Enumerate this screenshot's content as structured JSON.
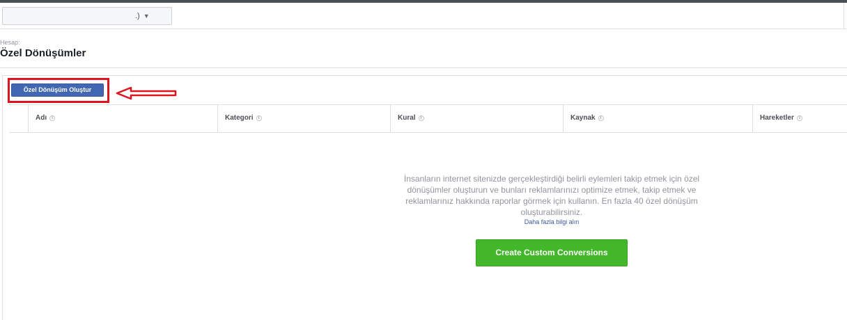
{
  "account_select": {
    "value": ".)",
    "caret": "▼"
  },
  "header": {
    "account_label": "Hesap:",
    "title": "Özel Dönüşümler"
  },
  "toolbar": {
    "create_button_label": "Özel Dönüşüm Oluştur"
  },
  "table": {
    "columns": [
      {
        "label": "Adı"
      },
      {
        "label": "Kategori"
      },
      {
        "label": "Kural"
      },
      {
        "label": "Kaynak"
      },
      {
        "label": "Hareketler"
      }
    ],
    "info_glyph": "i"
  },
  "empty_state": {
    "description": "İnsanların internet sitenizde gerçekleştirdiği belirli eylemleri takip etmek için özel dönüşümler oluşturun ve bunları reklamlarınızı optimize etmek, takip etmek ve reklamlarınız hakkında raporlar görmek için kullanın. En fazla 40 özel dönüşüm oluşturabilirsiniz.",
    "learn_more": "Daha fazla bilgi alın",
    "cta_label": "Create Custom Conversions"
  },
  "colors": {
    "primary_button": "#4267b2",
    "cta_button": "#42b72a",
    "annotation": "#e0141e",
    "link": "#365899"
  }
}
